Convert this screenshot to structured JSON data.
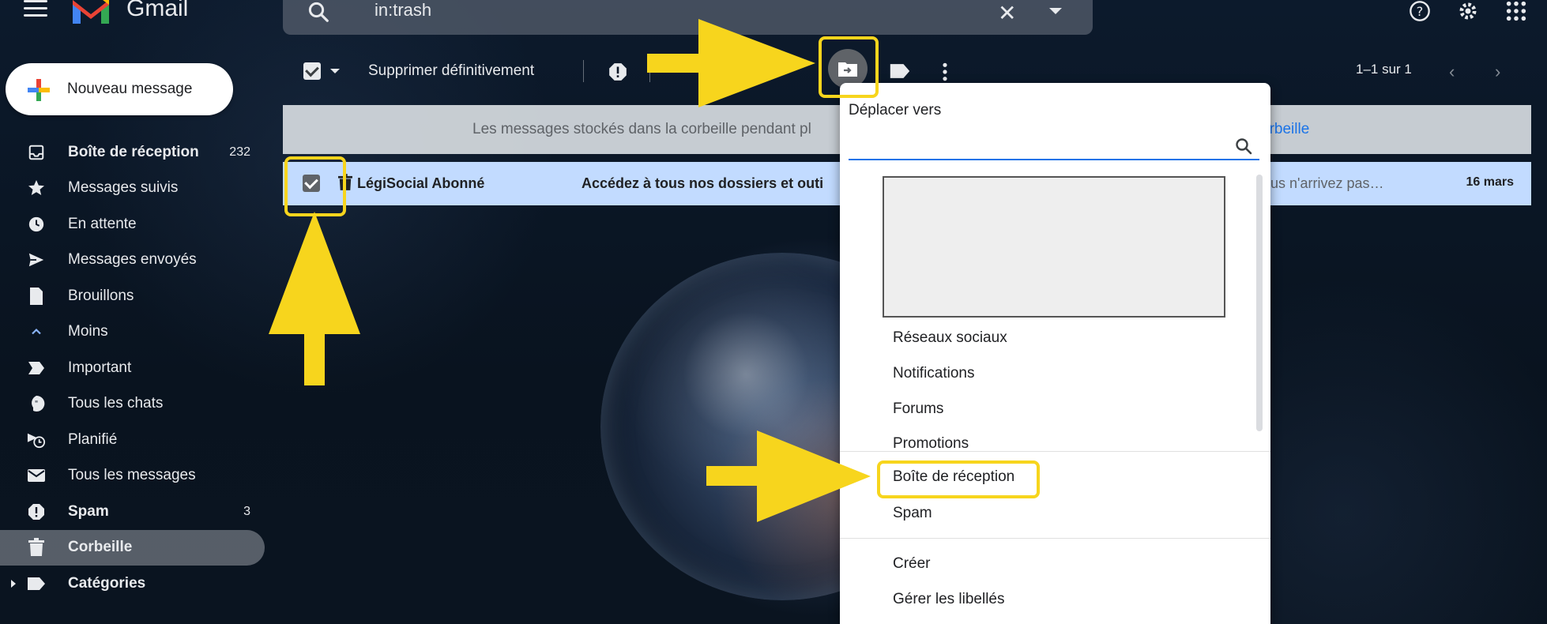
{
  "app": {
    "name": "Gmail"
  },
  "search": {
    "query": "in:trash"
  },
  "compose": {
    "label": "Nouveau message"
  },
  "sidebar": {
    "items": [
      {
        "label": "Boîte de réception",
        "count": "232",
        "bold": true
      },
      {
        "label": "Messages suivis",
        "count": ""
      },
      {
        "label": "En attente",
        "count": ""
      },
      {
        "label": "Messages envoyés",
        "count": ""
      },
      {
        "label": "Brouillons",
        "count": ""
      },
      {
        "label": "Moins",
        "count": ""
      },
      {
        "label": "Important",
        "count": ""
      },
      {
        "label": "Tous les chats",
        "count": ""
      },
      {
        "label": "Planifié",
        "count": ""
      },
      {
        "label": "Tous les messages",
        "count": ""
      },
      {
        "label": "Spam",
        "count": "3",
        "bold": true
      },
      {
        "label": "Corbeille",
        "count": "",
        "bold": true,
        "active": true
      },
      {
        "label": "Catégories",
        "count": "",
        "bold": true
      }
    ]
  },
  "toolbar": {
    "delete_forever_label": "Supprimer définitivement",
    "pager": "1–1 sur 1"
  },
  "banner": {
    "text": "Les messages stockés dans la corbeille pendant pl",
    "link": "orbeille"
  },
  "email": {
    "sender": "LégiSocial Abonné",
    "subject": "Accédez à tous nos dossiers et outi",
    "snippet": "ous n'arrivez pas…",
    "date": "16 mars"
  },
  "move_menu": {
    "title": "Déplacer vers",
    "items": [
      "Réseaux sociaux",
      "Notifications",
      "Forums",
      "Promotions"
    ],
    "system_items": [
      "Boîte de réception",
      "Spam"
    ],
    "actions": [
      "Créer",
      "Gérer les libellés"
    ]
  },
  "colors": {
    "highlight": "#f7d51d",
    "selected_row": "#c2dbff",
    "link": "#1a73e8"
  }
}
